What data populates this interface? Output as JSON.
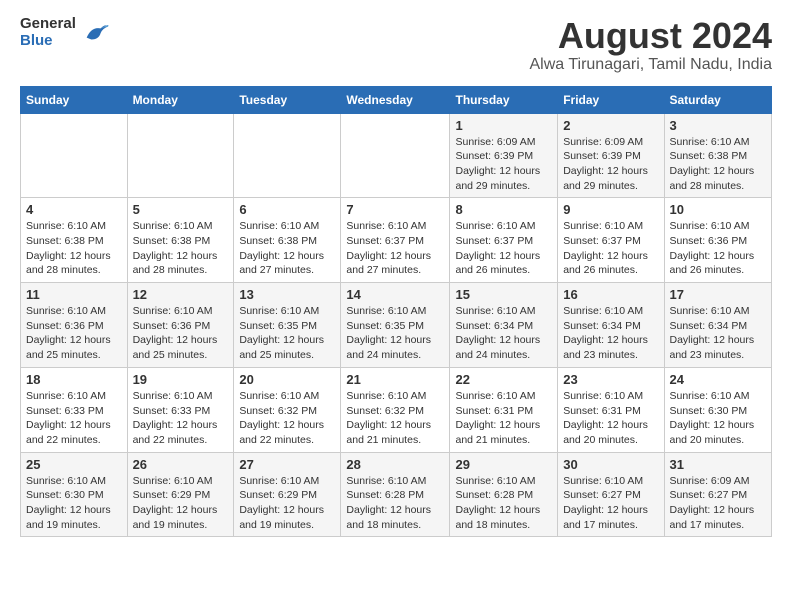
{
  "header": {
    "logo_general": "General",
    "logo_blue": "Blue",
    "month_year": "August 2024",
    "location": "Alwa Tirunagari, Tamil Nadu, India"
  },
  "weekdays": [
    "Sunday",
    "Monday",
    "Tuesday",
    "Wednesday",
    "Thursday",
    "Friday",
    "Saturday"
  ],
  "weeks": [
    [
      {
        "day": "",
        "info": ""
      },
      {
        "day": "",
        "info": ""
      },
      {
        "day": "",
        "info": ""
      },
      {
        "day": "",
        "info": ""
      },
      {
        "day": "1",
        "info": "Sunrise: 6:09 AM\nSunset: 6:39 PM\nDaylight: 12 hours and 29 minutes."
      },
      {
        "day": "2",
        "info": "Sunrise: 6:09 AM\nSunset: 6:39 PM\nDaylight: 12 hours and 29 minutes."
      },
      {
        "day": "3",
        "info": "Sunrise: 6:10 AM\nSunset: 6:38 PM\nDaylight: 12 hours and 28 minutes."
      }
    ],
    [
      {
        "day": "4",
        "info": "Sunrise: 6:10 AM\nSunset: 6:38 PM\nDaylight: 12 hours and 28 minutes."
      },
      {
        "day": "5",
        "info": "Sunrise: 6:10 AM\nSunset: 6:38 PM\nDaylight: 12 hours and 28 minutes."
      },
      {
        "day": "6",
        "info": "Sunrise: 6:10 AM\nSunset: 6:38 PM\nDaylight: 12 hours and 27 minutes."
      },
      {
        "day": "7",
        "info": "Sunrise: 6:10 AM\nSunset: 6:37 PM\nDaylight: 12 hours and 27 minutes."
      },
      {
        "day": "8",
        "info": "Sunrise: 6:10 AM\nSunset: 6:37 PM\nDaylight: 12 hours and 26 minutes."
      },
      {
        "day": "9",
        "info": "Sunrise: 6:10 AM\nSunset: 6:37 PM\nDaylight: 12 hours and 26 minutes."
      },
      {
        "day": "10",
        "info": "Sunrise: 6:10 AM\nSunset: 6:36 PM\nDaylight: 12 hours and 26 minutes."
      }
    ],
    [
      {
        "day": "11",
        "info": "Sunrise: 6:10 AM\nSunset: 6:36 PM\nDaylight: 12 hours and 25 minutes."
      },
      {
        "day": "12",
        "info": "Sunrise: 6:10 AM\nSunset: 6:36 PM\nDaylight: 12 hours and 25 minutes."
      },
      {
        "day": "13",
        "info": "Sunrise: 6:10 AM\nSunset: 6:35 PM\nDaylight: 12 hours and 25 minutes."
      },
      {
        "day": "14",
        "info": "Sunrise: 6:10 AM\nSunset: 6:35 PM\nDaylight: 12 hours and 24 minutes."
      },
      {
        "day": "15",
        "info": "Sunrise: 6:10 AM\nSunset: 6:34 PM\nDaylight: 12 hours and 24 minutes."
      },
      {
        "day": "16",
        "info": "Sunrise: 6:10 AM\nSunset: 6:34 PM\nDaylight: 12 hours and 23 minutes."
      },
      {
        "day": "17",
        "info": "Sunrise: 6:10 AM\nSunset: 6:34 PM\nDaylight: 12 hours and 23 minutes."
      }
    ],
    [
      {
        "day": "18",
        "info": "Sunrise: 6:10 AM\nSunset: 6:33 PM\nDaylight: 12 hours and 22 minutes."
      },
      {
        "day": "19",
        "info": "Sunrise: 6:10 AM\nSunset: 6:33 PM\nDaylight: 12 hours and 22 minutes."
      },
      {
        "day": "20",
        "info": "Sunrise: 6:10 AM\nSunset: 6:32 PM\nDaylight: 12 hours and 22 minutes."
      },
      {
        "day": "21",
        "info": "Sunrise: 6:10 AM\nSunset: 6:32 PM\nDaylight: 12 hours and 21 minutes."
      },
      {
        "day": "22",
        "info": "Sunrise: 6:10 AM\nSunset: 6:31 PM\nDaylight: 12 hours and 21 minutes."
      },
      {
        "day": "23",
        "info": "Sunrise: 6:10 AM\nSunset: 6:31 PM\nDaylight: 12 hours and 20 minutes."
      },
      {
        "day": "24",
        "info": "Sunrise: 6:10 AM\nSunset: 6:30 PM\nDaylight: 12 hours and 20 minutes."
      }
    ],
    [
      {
        "day": "25",
        "info": "Sunrise: 6:10 AM\nSunset: 6:30 PM\nDaylight: 12 hours and 19 minutes."
      },
      {
        "day": "26",
        "info": "Sunrise: 6:10 AM\nSunset: 6:29 PM\nDaylight: 12 hours and 19 minutes."
      },
      {
        "day": "27",
        "info": "Sunrise: 6:10 AM\nSunset: 6:29 PM\nDaylight: 12 hours and 19 minutes."
      },
      {
        "day": "28",
        "info": "Sunrise: 6:10 AM\nSunset: 6:28 PM\nDaylight: 12 hours and 18 minutes."
      },
      {
        "day": "29",
        "info": "Sunrise: 6:10 AM\nSunset: 6:28 PM\nDaylight: 12 hours and 18 minutes."
      },
      {
        "day": "30",
        "info": "Sunrise: 6:10 AM\nSunset: 6:27 PM\nDaylight: 12 hours and 17 minutes."
      },
      {
        "day": "31",
        "info": "Sunrise: 6:09 AM\nSunset: 6:27 PM\nDaylight: 12 hours and 17 minutes."
      }
    ]
  ]
}
